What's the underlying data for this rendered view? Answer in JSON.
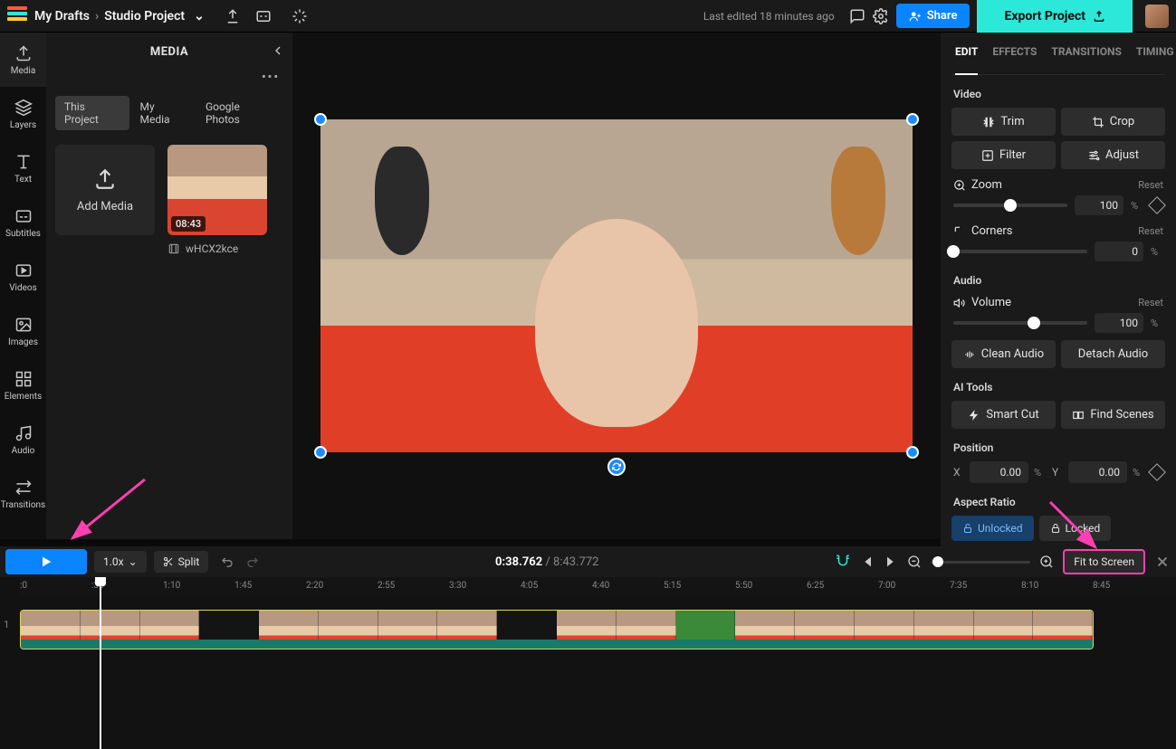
{
  "topbar": {
    "breadcrumb_root": "My Drafts",
    "breadcrumb_project": "Studio Project",
    "last_edited": "Last edited 18 minutes ago",
    "share": "Share",
    "export": "Export Project"
  },
  "leftrail": {
    "items": [
      "Media",
      "Layers",
      "Text",
      "Subtitles",
      "Videos",
      "Images",
      "Elements",
      "Audio",
      "Transitions"
    ]
  },
  "media": {
    "title": "MEDIA",
    "tabs": [
      "This Project",
      "My Media",
      "Google Photos"
    ],
    "add_label": "Add Media",
    "clip": {
      "duration": "08:43",
      "name": "wHCX2kce"
    }
  },
  "rp": {
    "tabs": [
      "EDIT",
      "EFFECTS",
      "TRANSITIONS",
      "TIMING"
    ],
    "video_label": "Video",
    "trim": "Trim",
    "crop": "Crop",
    "filter": "Filter",
    "adjust": "Adjust",
    "zoom": "Zoom",
    "zoom_val": "100",
    "reset": "Reset",
    "corners": "Corners",
    "corners_val": "0",
    "audio_label": "Audio",
    "volume": "Volume",
    "volume_val": "100",
    "clean_audio": "Clean Audio",
    "detach_audio": "Detach Audio",
    "ai_label": "AI Tools",
    "smart_cut": "Smart Cut",
    "find_scenes": "Find Scenes",
    "position_label": "Position",
    "pos_x": "0.00",
    "pos_y": "0.00",
    "aspect_label": "Aspect Ratio",
    "unlocked": "Unlocked",
    "locked": "Locked",
    "pct": "%"
  },
  "tlc": {
    "speed": "1.0x",
    "split": "Split",
    "current": "0:38.762",
    "total": "8:43.772",
    "fit": "Fit to Screen"
  },
  "ruler": [
    ":0",
    ":35",
    "1:10",
    "1:45",
    "2:20",
    "2:55",
    "3:30",
    "4:05",
    "4:40",
    "5:15",
    "5:50",
    "6:25",
    "7:00",
    "7:35",
    "8:10",
    "8:45"
  ]
}
